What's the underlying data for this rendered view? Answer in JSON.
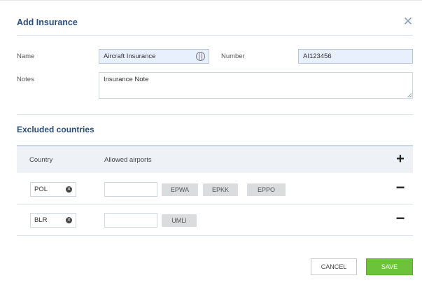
{
  "dialog": {
    "title": "Add Insurance",
    "close_icon": "close-icon"
  },
  "form": {
    "name_label": "Name",
    "name_value": "Aircraft Insurance",
    "number_label": "Number",
    "number_value": "AI123456",
    "notes_label": "Notes",
    "notes_value": "Insurance Note",
    "name_field_icon": "globe-icon"
  },
  "excluded": {
    "title": "Excluded countries",
    "headers": {
      "country": "Country",
      "allowed_airports": "Allowed airports"
    },
    "add_icon": "plus-icon",
    "remove_icon": "minus-icon",
    "rows": [
      {
        "country": "POL",
        "airports": [
          "EPWA",
          "EPKK",
          "EPPO"
        ]
      },
      {
        "country": "BLR",
        "airports": [
          "UMLI"
        ]
      }
    ]
  },
  "actions": {
    "cancel_label": "CANCEL",
    "save_label": "SAVE"
  },
  "colors": {
    "accent": "#2a4d7a",
    "field_bg": "#e8f0fe",
    "save": "#6cc33a"
  }
}
